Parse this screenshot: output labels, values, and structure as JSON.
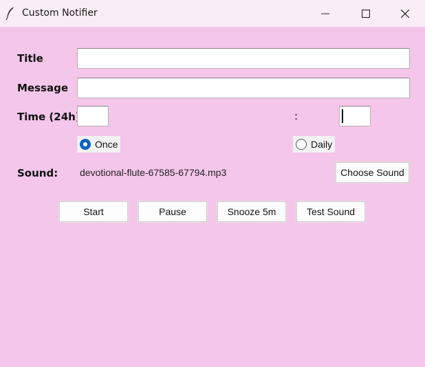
{
  "window": {
    "title": "Custom Notifier",
    "icon": "feather-icon"
  },
  "form": {
    "title_label": "Title",
    "message_label": "Message",
    "time_label": "Time (24h)",
    "time_separator": ":",
    "title_value": "",
    "message_value": "",
    "hour_value": "",
    "minute_value": ""
  },
  "repeat": {
    "options": [
      "Once",
      "Daily"
    ],
    "selected": "Once"
  },
  "sound": {
    "label": "Sound:",
    "file": "devotional-flute-67585-67794.mp3",
    "choose_label": "Choose Sound"
  },
  "actions": {
    "start": "Start",
    "pause": "Pause",
    "snooze": "Snooze 5m",
    "test_sound": "Test Sound"
  },
  "colors": {
    "background": "#f4c6ea",
    "titlebar": "#f9eef3",
    "radio_selected": "#0a63c4"
  }
}
